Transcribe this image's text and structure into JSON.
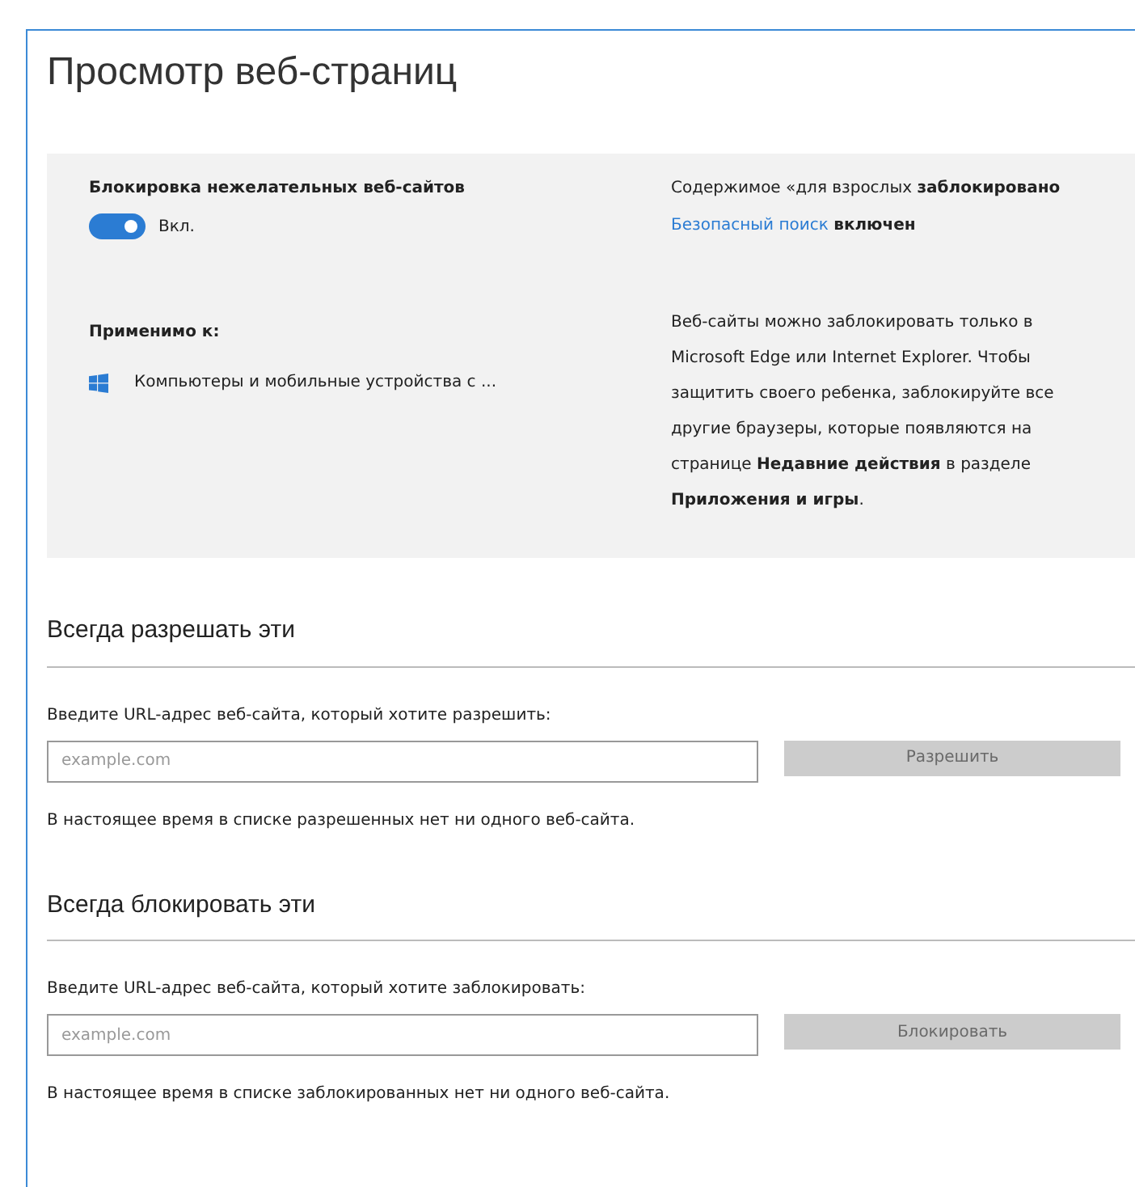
{
  "title": "Просмотр веб-страниц",
  "filter": {
    "label": "Блокировка нежелательных веб-сайтов",
    "toggle": {
      "on": true,
      "state_label": "Вкл."
    },
    "adult_status": "Содержимое «для взрослых **заблокировано**",
    "safe_search_link": "Безопасный поиск",
    "safe_search_state": "включен",
    "applies_label": "Применимо к:",
    "device": "Компьютеры и мобильные устройства с ...",
    "note": "Веб-сайты можно заблокировать только в Microsoft Edge или Internet Explorer. Чтобы защитить своего ребенка, заблокируйте все другие браузеры, которые появляются на странице **Недавние действия** в разделе **Приложения и игры**."
  },
  "sections": [
    {
      "heading": "Всегда разрешать эти",
      "label": "Введите URL-адрес веб-сайта, который хотите разрешить:",
      "placeholder": "example.com",
      "button": {
        "label": "Разрешить",
        "disabled": true
      },
      "note": "В настоящее время в списке разрешенных нет ни одного веб-сайта."
    },
    {
      "heading": "Всегда блокировать эти",
      "label": "Введите URL-адрес веб-сайта, который хотите заблокировать:",
      "placeholder": "example.com",
      "button": {
        "label": "Блокировать",
        "disabled": true
      },
      "note": "В настоящее время в списке заблокированных нет ни одного веб-сайта."
    }
  ]
}
